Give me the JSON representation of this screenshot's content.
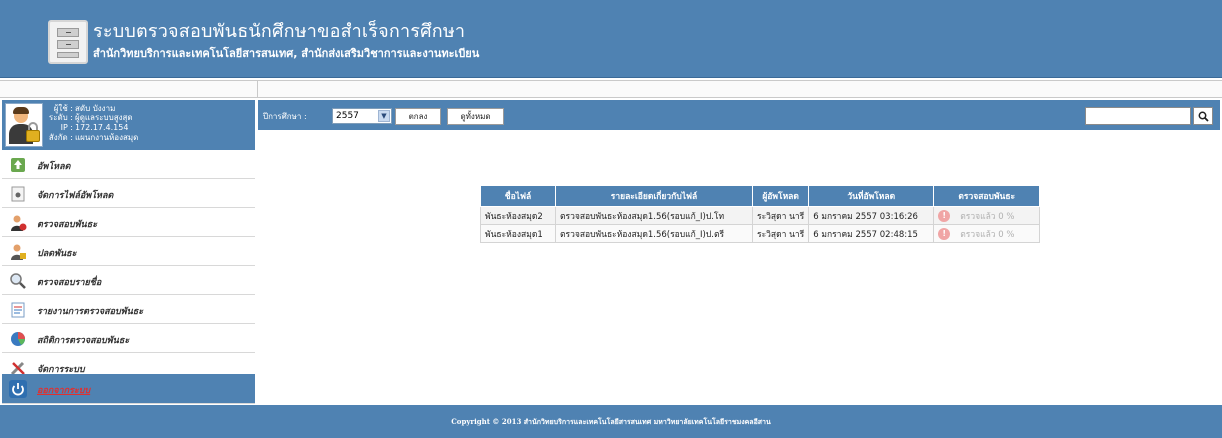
{
  "header": {
    "title": "ระบบตรวจสอบพันธนักศึกษาขอสำเร็จการศึกษา",
    "subtitle": "สำนักวิทยบริการและเทคโนโลยีสารสนเทศ, สำนักส่งเสริมวิชาการและงานทะเบียน"
  },
  "user": {
    "rows": [
      {
        "label": "ผู้ใช้ :",
        "value": "สดับ บังงาม"
      },
      {
        "label": "ระดับ :",
        "value": "ผู้ดูแลระบบสูงสุด"
      },
      {
        "label": "IP :",
        "value": "172.17.4.154"
      },
      {
        "label": "สังกัด :",
        "value": "แผนกงานห้องสมุด"
      }
    ]
  },
  "sidebar": {
    "items": [
      {
        "label": "อัพโหลด",
        "icon": "upload-icon"
      },
      {
        "label": "จัดการไฟล์อัพโหลด",
        "icon": "file-manage-icon"
      },
      {
        "label": "ตรวจสอบพันธะ",
        "icon": "user-check-icon"
      },
      {
        "label": "ปลดพันธะ",
        "icon": "user-release-icon"
      },
      {
        "label": "ตรวจสอบรายชื่อ",
        "icon": "magnifier-icon"
      },
      {
        "label": "รายงานการตรวจสอบพันธะ",
        "icon": "report-icon"
      },
      {
        "label": "สถิติการตรวจสอบพันธะ",
        "icon": "pie-chart-icon"
      },
      {
        "label": "จัดการระบบ",
        "icon": "tools-icon"
      },
      {
        "label": "ออกจากระบบ",
        "icon": "power-icon"
      }
    ]
  },
  "toolbar": {
    "year_label": "ปีการศึกษา :",
    "year_value": "2557",
    "ok_label": "ตกลง",
    "show_all_label": "ดูทั้งหมด",
    "search_placeholder": ""
  },
  "table": {
    "headers": [
      "ชื่อไฟล์",
      "รายละเอียดเกี่ยวกับไฟล์",
      "ผู้อัพโหลด",
      "วันที่อัพโหลด",
      "ตรวจสอบพันธะ"
    ],
    "rows": [
      {
        "file": "พันธะห้องสมุด2",
        "detail": "ตรวจสอบพันธะห้องสมุด1.56(รอบแก้_I)ป.โท",
        "uploader": "ระวิสุดา นารี",
        "date": "6 มกราคม 2557 03:16:26",
        "status": "ตรวจแล้ว 0 %"
      },
      {
        "file": "พันธะห้องสมุด1",
        "detail": "ตรวจสอบพันธะห้องสมุด1.56(รอบแก้_I)ป.ตรี",
        "uploader": "ระวิสุดา นารี",
        "date": "6 มกราคม 2557 02:48:15",
        "status": "ตรวจแล้ว 0 %"
      }
    ]
  },
  "footer": {
    "copyright": "Copyright © 2013 สำนักวิทยบริการและเทคโนโลยีสารสนเทศ มหาวิทยาลัยเทคโนโลยีราชมงคลอีสาน"
  },
  "colors": {
    "brand": "#4f82b2",
    "logout_text": "#e03030"
  }
}
